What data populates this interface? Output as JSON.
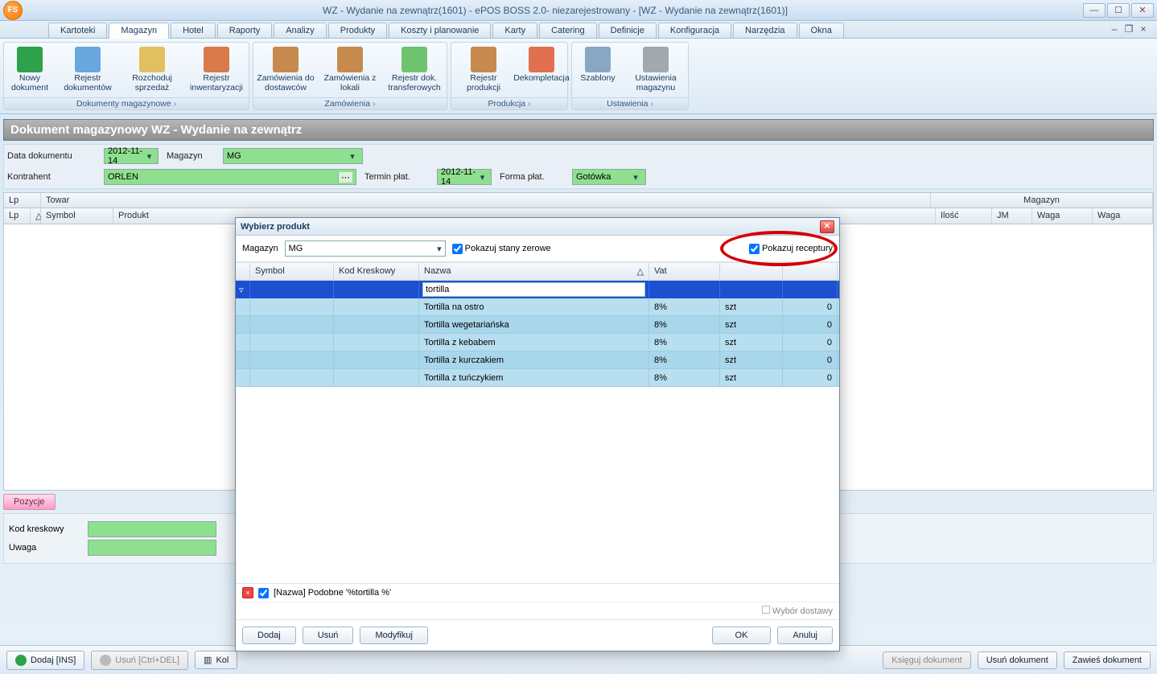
{
  "window": {
    "title": "WZ - Wydanie na zewnątrz(1601) - ePOS BOSS 2.0- niezarejestrowany - [WZ - Wydanie na zewnątrz(1601)]",
    "logo_text": "FS"
  },
  "menu_tabs": [
    "Kartoteki",
    "Magazyn",
    "Hotel",
    "Raporty",
    "Analizy",
    "Produkty",
    "Koszty i planowanie",
    "Karty",
    "Catering",
    "Definicje",
    "Konfiguracja",
    "Narzędzia",
    "Okna"
  ],
  "active_tab_index": 1,
  "ribbon": {
    "groups": [
      {
        "label": "Dokumenty magazynowe",
        "items": [
          {
            "name": "Nowy dokument",
            "icon": "#2ea24a"
          },
          {
            "name": "Rejestr dokumentów",
            "icon": "#6aa7de"
          },
          {
            "name": "Rozchoduj sprzedaż",
            "icon": "#e0c060"
          },
          {
            "name": "Rejestr inwentaryzacji",
            "icon": "#d97a4a"
          }
        ]
      },
      {
        "label": "Zamówienia",
        "items": [
          {
            "name": "Zamówienia do dostawców",
            "icon": "#c78a4e"
          },
          {
            "name": "Zamówienia z lokali",
            "icon": "#c78a4e"
          },
          {
            "name": "Rejestr dok. transferowych",
            "icon": "#6ec46e"
          }
        ]
      },
      {
        "label": "Produkcja",
        "items": [
          {
            "name": "Rejestr produkcji",
            "icon": "#c78a4e"
          },
          {
            "name": "Dekompletacja",
            "icon": "#e07050"
          }
        ]
      },
      {
        "label": "Ustawienia",
        "items": [
          {
            "name": "Szablony",
            "icon": "#88a7c4"
          },
          {
            "name": "Ustawienia magazynu",
            "icon": "#a0a8b0"
          }
        ]
      }
    ]
  },
  "document": {
    "header": "Dokument magazynowy WZ - Wydanie na zewnątrz",
    "fields": {
      "data_label": "Data dokumentu",
      "data_value": "2012-11-14",
      "magazyn_label": "Magazyn",
      "magazyn_value": "MG",
      "kontrahent_label": "Kontrahent",
      "kontrahent_value": "ORLEN",
      "termin_label": "Termin płat.",
      "termin_value": "2012-11-14",
      "forma_label": "Forma płat.",
      "forma_value": "Gotówka"
    }
  },
  "grid": {
    "head1": {
      "lp": "Lp",
      "towar": "Towar",
      "magazyn": "Magazyn"
    },
    "head2": {
      "lp": "Lp",
      "sort": "△",
      "symbol": "Symbol",
      "produkt": "Produkt",
      "ilosc": "Ilość",
      "jm": "JM",
      "waga1": "Waga",
      "waga2": "Waga"
    }
  },
  "tabstrip": {
    "pozycje": "Pozycje"
  },
  "lower": {
    "kod_label": "Kod kreskowy",
    "uwaga_label": "Uwaga"
  },
  "bottombar": {
    "dodaj": "Dodaj [INS]",
    "usun": "Usuń [Ctrl+DEL]",
    "kol": "Kol",
    "ksieguj": "Księguj dokument",
    "usundok": "Usuń dokument",
    "zawies": "Zawieś dokument"
  },
  "modal": {
    "title": "Wybierz produkt",
    "magazyn_label": "Magazyn",
    "magazyn_value": "MG",
    "chk_zero": "Pokazuj stany zerowe",
    "chk_recept": "Pokazuj receptury",
    "columns": {
      "symbol": "Symbol",
      "kod": "Kod Kreskowy",
      "nazwa": "Nazwa",
      "vat": "Vat",
      "jm": "",
      "stan": ""
    },
    "filter_nazwa": "tortilla ",
    "rows": [
      {
        "nazwa": "Tortilla na ostro",
        "vat": "8%",
        "jm": "szt",
        "stan": "0"
      },
      {
        "nazwa": "Tortilla wegetariańska",
        "vat": "8%",
        "jm": "szt",
        "stan": "0"
      },
      {
        "nazwa": "Tortilla z kebabem",
        "vat": "8%",
        "jm": "szt",
        "stan": "0"
      },
      {
        "nazwa": "Tortilla z kurczakiem",
        "vat": "8%",
        "jm": "szt",
        "stan": "0"
      },
      {
        "nazwa": "Tortilla z tuńczykiem",
        "vat": "8%",
        "jm": "szt",
        "stan": "0"
      }
    ],
    "status": "[Nazwa] Podobne '%tortilla %'",
    "wybor": "Wybór dostawy",
    "btn_dodaj": "Dodaj",
    "btn_usun": "Usuń",
    "btn_mod": "Modyfikuj",
    "btn_ok": "OK",
    "btn_anuluj": "Anuluj"
  }
}
